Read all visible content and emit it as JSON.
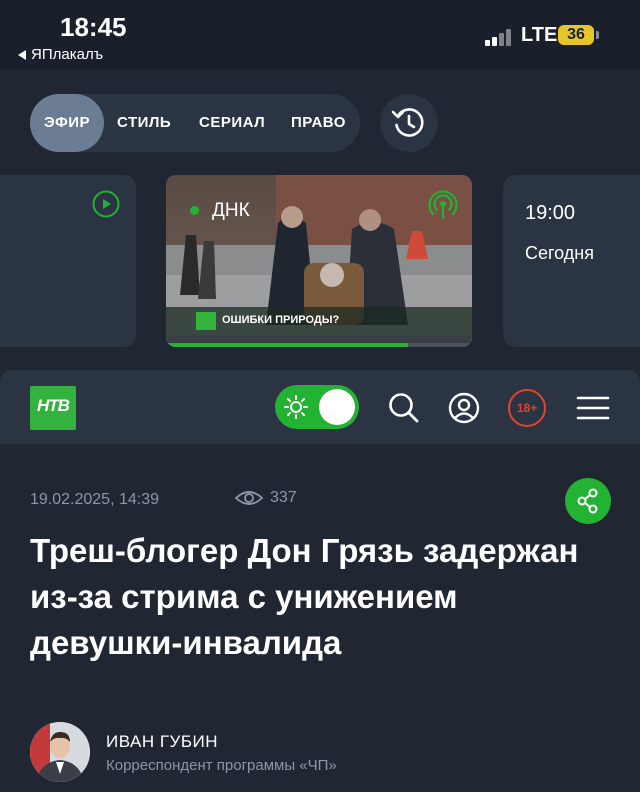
{
  "status_bar": {
    "time": "18:45",
    "back_label": "ЯПлакалъ",
    "network": "LTE",
    "battery": "36"
  },
  "tabs": [
    {
      "label": "ЭФИР",
      "active": true
    },
    {
      "label": "СТИЛЬ",
      "active": false
    },
    {
      "label": "СЕРИАЛ",
      "active": false
    },
    {
      "label": "ПРАВО",
      "active": false
    }
  ],
  "live_card": {
    "program": "ДНК",
    "banner": "ОШИБКИ ПРИРОДЫ?",
    "progress": 0.79
  },
  "next_card": {
    "time": "19:00",
    "day": "Сегодня"
  },
  "header": {
    "logo_text": "НТВ",
    "age_rating": "18+"
  },
  "article": {
    "date": "19.02.2025, 14:39",
    "views": "337",
    "title": "Треш-блогер Дон Грязь задержан из-за стрима с унижением девушки-инвалида",
    "author_name": "ИВАН ГУБИН",
    "author_role": "Корреспондент программы «ЧП»"
  },
  "colors": {
    "background": "#202733",
    "panel": "#2b3442",
    "accent_green": "#23b233",
    "active_tab": "#6c7d93",
    "muted_text": "#8d96a4",
    "age_badge": "#e0442f"
  },
  "icons": [
    "play-icon",
    "live-broadcast-icon",
    "history-icon",
    "sun-icon",
    "search-icon",
    "profile-icon",
    "menu-icon",
    "eye-icon",
    "share-icon"
  ]
}
